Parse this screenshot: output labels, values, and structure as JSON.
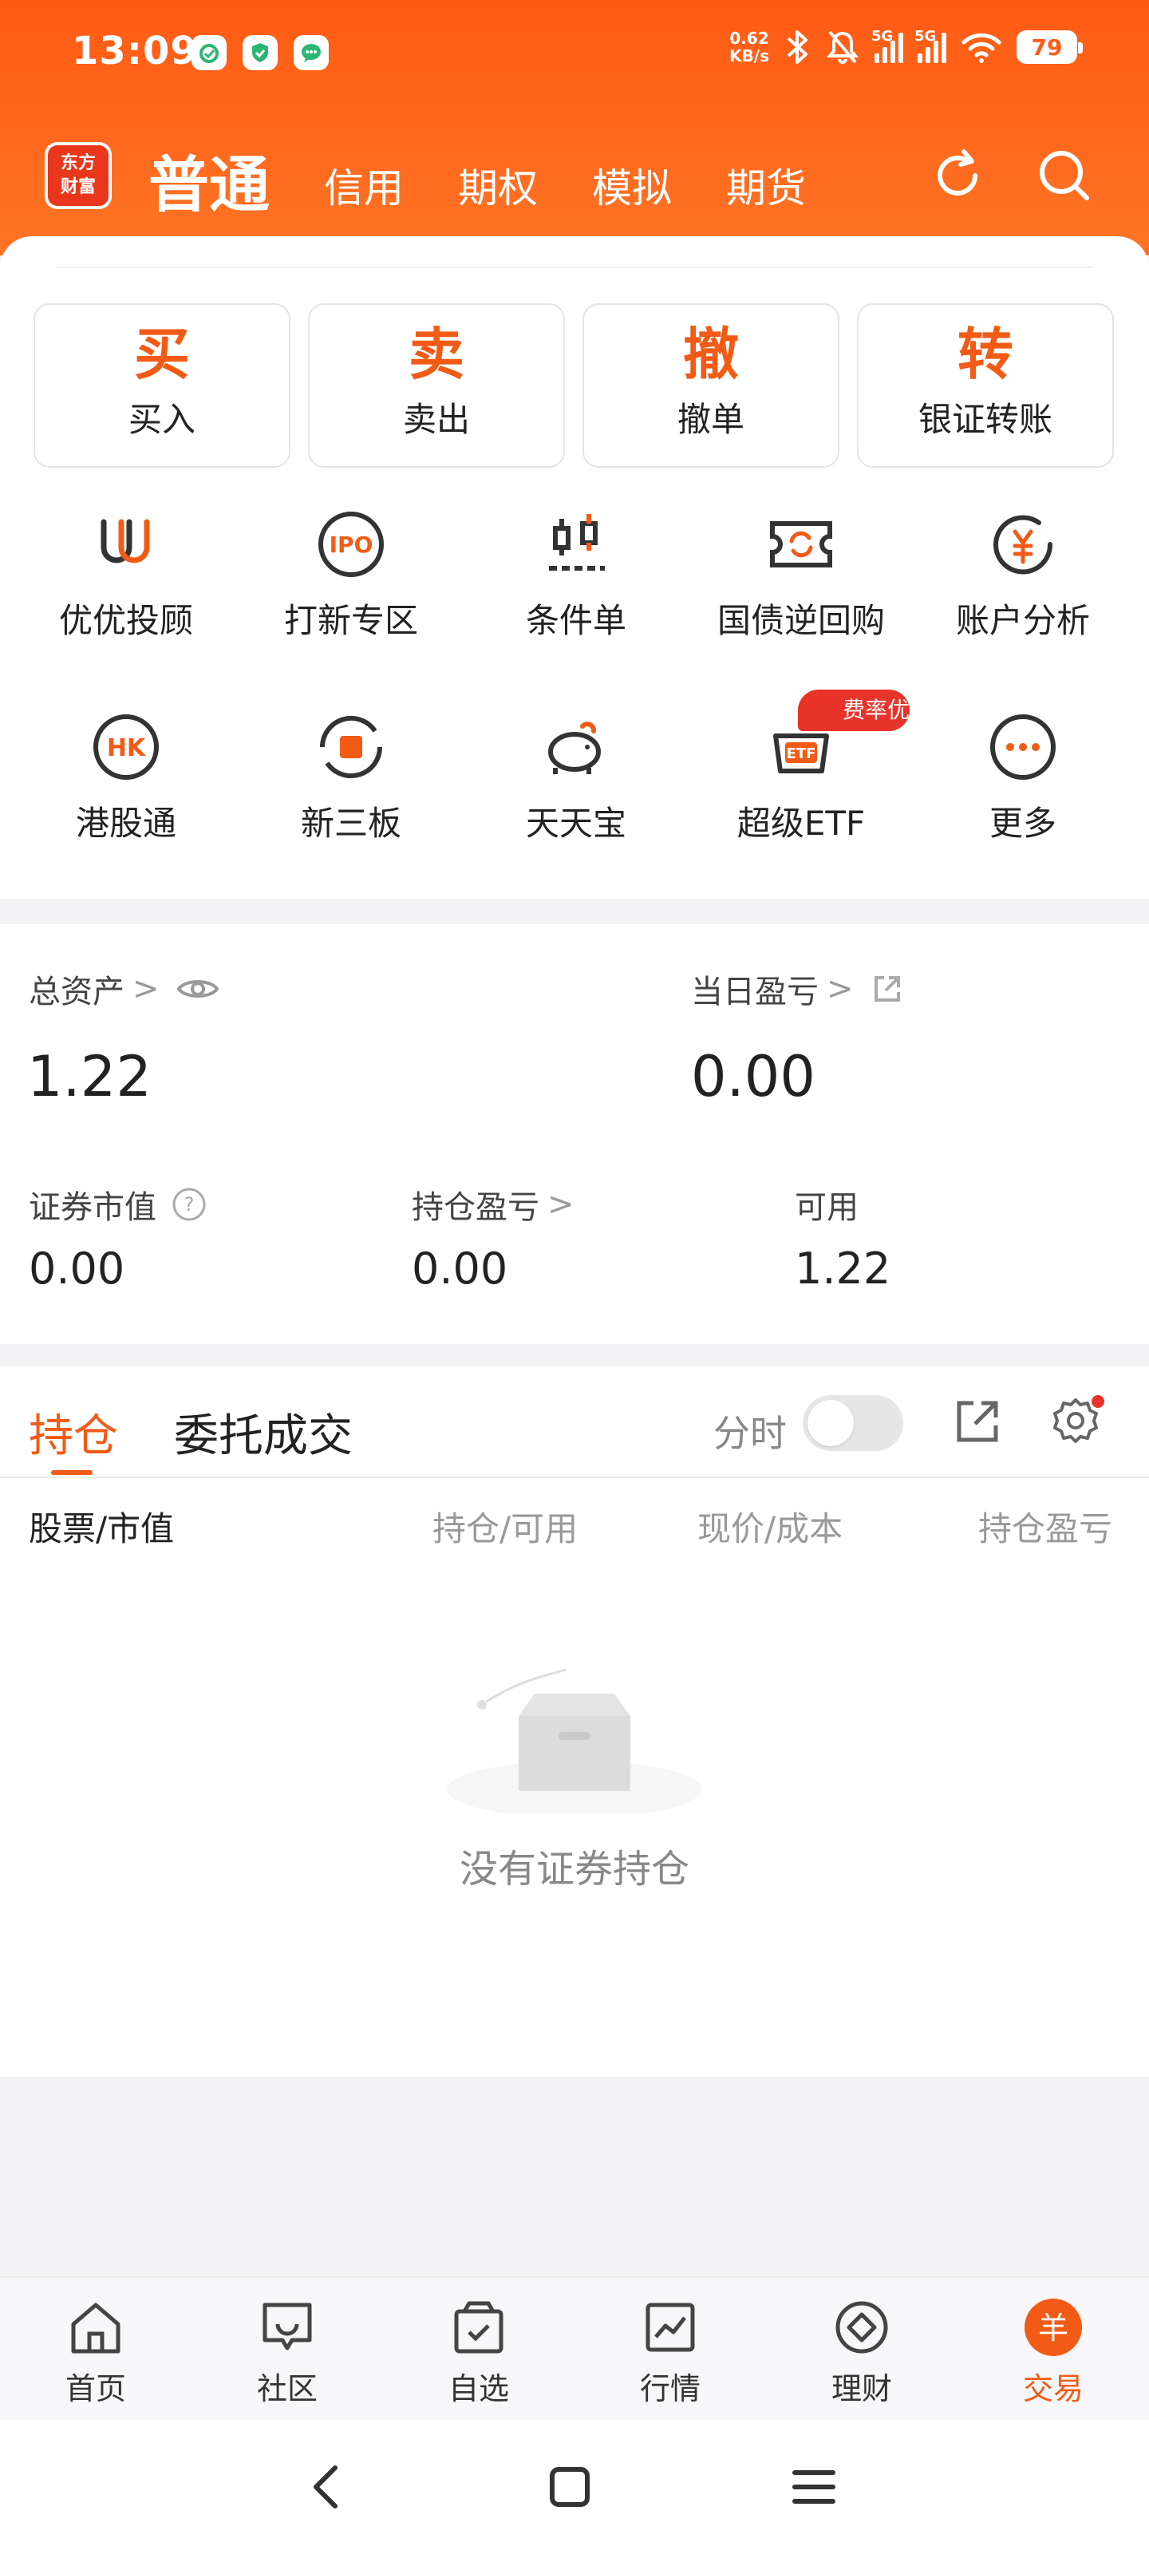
{
  "status_bar": {
    "time": "13:09",
    "net_speed_value": "0.62",
    "net_speed_unit": "KB/s",
    "signal1_label": "5G",
    "signal2_label": "5G",
    "battery": "79",
    "icons": [
      "shield-app-icon",
      "security-app-icon",
      "chat-app-icon",
      "bluetooth-icon",
      "mute-icon",
      "signal-icon",
      "wifi-icon",
      "battery-icon"
    ]
  },
  "header": {
    "logo_line1": "东方",
    "logo_line2": "财富",
    "tabs": [
      "普通",
      "信用",
      "期权",
      "模拟",
      "期货"
    ],
    "active_tab": "普通"
  },
  "quick_actions": [
    {
      "big": "买",
      "label": "买入"
    },
    {
      "big": "卖",
      "label": "卖出"
    },
    {
      "big": "撤",
      "label": "撤单"
    },
    {
      "big": "转",
      "label": "银证转账"
    }
  ],
  "services": [
    {
      "label": "优优投顾",
      "icon": "uu-advisor-icon"
    },
    {
      "label": "打新专区",
      "icon": "ipo-icon"
    },
    {
      "label": "条件单",
      "icon": "conditional-order-icon"
    },
    {
      "label": "国债逆回购",
      "icon": "bond-repo-icon"
    },
    {
      "label": "账户分析",
      "icon": "account-analysis-icon"
    },
    {
      "label": "港股通",
      "icon": "hk-connect-icon"
    },
    {
      "label": "新三板",
      "icon": "neeq-icon"
    },
    {
      "label": "天天宝",
      "icon": "piggy-bank-icon"
    },
    {
      "label": "超级ETF",
      "icon": "etf-icon"
    },
    {
      "label": "更多",
      "icon": "more-icon"
    }
  ],
  "fee_badge": "费率优",
  "assets": {
    "total_label": "总资产",
    "total_value": "1.22",
    "daily_pl_label": "当日盈亏",
    "daily_pl_value": "0.00",
    "market_value_label": "证券市值",
    "market_value": "0.00",
    "position_pl_label": "持仓盈亏",
    "position_pl_value": "0.00",
    "available_label": "可用",
    "available_value": "1.22"
  },
  "positions": {
    "tabs": [
      "持仓",
      "委托成交"
    ],
    "timeshare_label": "分时",
    "timeshare_on": false,
    "columns": [
      "股票/市值",
      "持仓/可用",
      "现价/成本",
      "持仓盈亏"
    ],
    "empty_text": "没有证券持仓"
  },
  "bottom_nav": [
    {
      "label": "首页",
      "icon": "home-icon"
    },
    {
      "label": "社区",
      "icon": "community-icon"
    },
    {
      "label": "自选",
      "icon": "watchlist-icon"
    },
    {
      "label": "行情",
      "icon": "market-icon"
    },
    {
      "label": "理财",
      "icon": "wealth-icon"
    },
    {
      "label": "交易",
      "icon": "trade-icon"
    }
  ],
  "active_bottom_tab": "交易",
  "colors": {
    "brand": "#ff5a14",
    "accent": "#f25b16",
    "alert": "#e8332a"
  }
}
